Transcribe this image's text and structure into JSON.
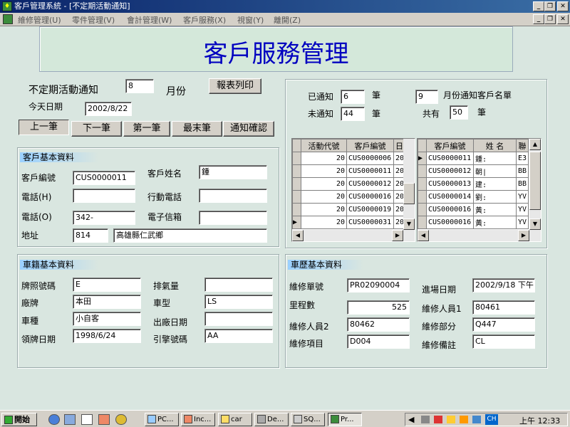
{
  "window": {
    "title": "客戶管理系統 - [不定期活動通知]",
    "min": "_",
    "restore": "❐",
    "close": "✕"
  },
  "menu": [
    "維修管理(U)",
    "零件管理(V)",
    "會計管理(W)",
    "客戶服務(X)",
    "視窗(Y)",
    "離開(Z)"
  ],
  "header": {
    "title": "客戶服務管理"
  },
  "notice": {
    "label": "不定期活動通知",
    "month_value": "8",
    "month_unit": "月份",
    "print_button": "報表列印",
    "today_label": "今天日期",
    "today_value": "2002/8/22"
  },
  "nav": {
    "prev": "上一筆",
    "next": "下一筆",
    "first": "第一筆",
    "last": "最末筆",
    "confirm": "通知確認"
  },
  "stats": {
    "notified_label": "已通知",
    "notified_value": "6",
    "notified_unit": "筆",
    "pending_label": "未通知",
    "pending_value": "44",
    "pending_unit": "筆",
    "month_value": "9",
    "month_list_label": "月份通知客戶名單",
    "total_label": "共有",
    "total_value": "50",
    "total_unit": "筆"
  },
  "grid_left": {
    "headers": [
      "活動代號",
      "客戶編號",
      "日E"
    ],
    "rows": [
      [
        "20",
        "CUS0000006",
        "20"
      ],
      [
        "20",
        "CUS0000011",
        "20"
      ],
      [
        "20",
        "CUS0000012",
        "20"
      ],
      [
        "20",
        "CUS0000016",
        "20"
      ],
      [
        "20",
        "CUS0000019",
        "20"
      ],
      [
        "20",
        "CUS0000031",
        "20"
      ]
    ]
  },
  "grid_right": {
    "headers": [
      "客戶編號",
      "姓 名",
      "聯"
    ],
    "rows": [
      [
        "CUS0000011",
        "鍾:",
        "E3"
      ],
      [
        "CUS0000012",
        "朝|",
        "BB"
      ],
      [
        "CUS0000013",
        "建:",
        "BB"
      ],
      [
        "CUS0000014",
        "劉:",
        "YV"
      ],
      [
        "CUS0000016",
        "黃:",
        "YV"
      ],
      [
        "CUS0000016",
        "黃:",
        "YV"
      ]
    ]
  },
  "customer": {
    "section": "客戶基本資料",
    "id_label": "客戶編號",
    "id_value": "CUS0000011",
    "name_label": "客戶姓名",
    "name_value": "鍾",
    "phone_h_label": "電話(H)",
    "phone_h_value": "",
    "mobile_label": "行動電話",
    "mobile_value": "",
    "phone_o_label": "電話(O)",
    "phone_o_value": "342-",
    "email_label": "電子信箱",
    "email_value": "",
    "addr_label": "地址",
    "zip_value": "814",
    "addr_value": "高雄縣仁武鄉"
  },
  "vehicle": {
    "section": "車籍基本資料",
    "plate_label": "牌照號碼",
    "plate_value": "E",
    "cc_label": "排氣量",
    "cc_value": "",
    "brand_label": "廠牌",
    "brand_value": "本田",
    "model_label": "車型",
    "model_value": "LS",
    "type_label": "車種",
    "type_value": "小自客",
    "mfg_label": "出廠日期",
    "mfg_value": "",
    "license_label": "領牌日期",
    "license_value": "1998/6/24",
    "engine_label": "引擎號碼",
    "engine_value": "AA"
  },
  "repair": {
    "section": "車歷基本資料",
    "order_label": "維修單號",
    "order_value": "PR02090004",
    "entry_label": "進場日期",
    "entry_value": "2002/9/18 下午",
    "mileage_label": "里程數",
    "mileage_value": "525",
    "staff1_label": "維修人員1",
    "staff1_value": "80461",
    "staff2_label": "維修人員2",
    "staff2_value": "80462",
    "dept_label": "維修部分",
    "dept_value": "Q447",
    "item_label": "維修項目",
    "item_value": "D004",
    "note_label": "維修備註",
    "note_value": "CL"
  },
  "taskbar": {
    "start": "開始",
    "tasks": [
      "PC...",
      "Inc...",
      "car",
      "De...",
      "SQ...",
      "Pr..."
    ],
    "clock": "上午 12:33",
    "ime": "CH"
  },
  "colors": {
    "title_blue": "#0000c0",
    "window_bg": "#d9e6e0",
    "titlebar": "#0a246a"
  }
}
